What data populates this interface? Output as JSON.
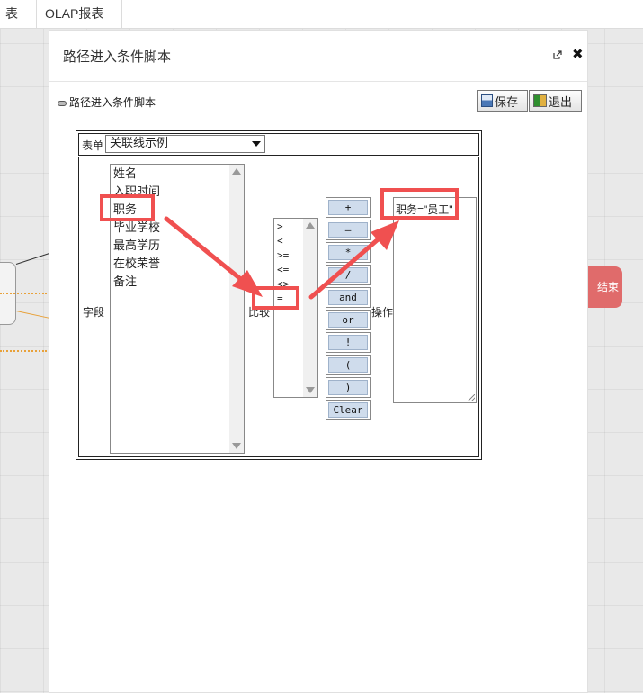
{
  "topbar": {
    "tab1_label": "表",
    "tab2_label": "OLAP报表"
  },
  "background": {
    "end_node_label": "结束"
  },
  "modal": {
    "title": "路径进入条件脚本",
    "subtitle": "路径进入条件脚本",
    "save_label": "保存",
    "exit_label": "退出"
  },
  "form": {
    "table_label": "表单",
    "table_select_value": "关联线示例",
    "field_label": "字段",
    "compare_label": "比较",
    "operation_label": "操作",
    "fields": [
      "姓名",
      "入职时间",
      "职务",
      "毕业学校",
      "最高学历",
      "在校荣誉",
      "备注"
    ],
    "comparators": [
      ">",
      "<",
      ">=",
      "<=",
      "<>",
      "="
    ],
    "operators": [
      "+",
      "—",
      "*",
      "/",
      "and",
      "or",
      "!",
      "(",
      ")",
      "Clear"
    ],
    "expression_value": "职务=\"员工\""
  },
  "annotation": {
    "highlight_color": "#f05050"
  },
  "icons": [
    "external-link-icon",
    "close-icon",
    "pin-icon",
    "save-icon",
    "exit-icon",
    "dropdown-caret-icon"
  ]
}
